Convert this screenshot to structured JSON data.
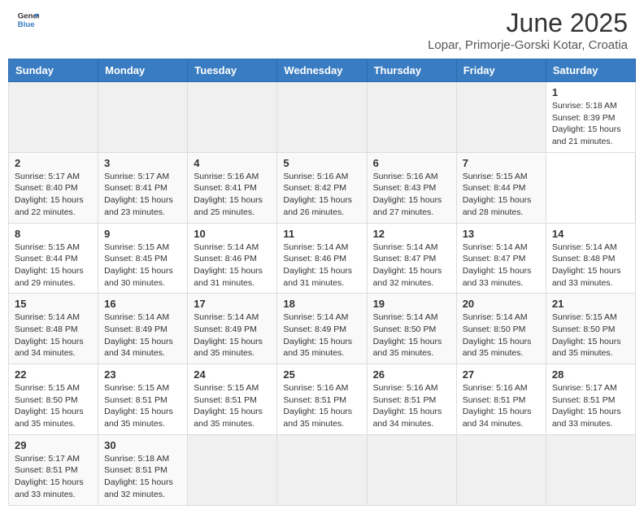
{
  "header": {
    "logo": {
      "general": "General",
      "blue": "Blue"
    },
    "title": "June 2025",
    "location": "Lopar, Primorje-Gorski Kotar, Croatia"
  },
  "calendar": {
    "days": [
      "Sunday",
      "Monday",
      "Tuesday",
      "Wednesday",
      "Thursday",
      "Friday",
      "Saturday"
    ],
    "weeks": [
      [
        null,
        null,
        null,
        null,
        null,
        null,
        {
          "day": "1",
          "sunrise": "5:18 AM",
          "sunset": "8:39 PM",
          "daylight_hours": "15",
          "daylight_minutes": "21"
        }
      ],
      [
        {
          "day": "2",
          "sunrise": "5:17 AM",
          "sunset": "8:40 PM",
          "daylight_hours": "15",
          "daylight_minutes": "22"
        },
        {
          "day": "3",
          "sunrise": "5:17 AM",
          "sunset": "8:41 PM",
          "daylight_hours": "15",
          "daylight_minutes": "23"
        },
        {
          "day": "4",
          "sunrise": "5:16 AM",
          "sunset": "8:41 PM",
          "daylight_hours": "15",
          "daylight_minutes": "25"
        },
        {
          "day": "5",
          "sunrise": "5:16 AM",
          "sunset": "8:42 PM",
          "daylight_hours": "15",
          "daylight_minutes": "26"
        },
        {
          "day": "6",
          "sunrise": "5:16 AM",
          "sunset": "8:43 PM",
          "daylight_hours": "15",
          "daylight_minutes": "27"
        },
        {
          "day": "7",
          "sunrise": "5:15 AM",
          "sunset": "8:44 PM",
          "daylight_hours": "15",
          "daylight_minutes": "28"
        }
      ],
      [
        {
          "day": "8",
          "sunrise": "5:15 AM",
          "sunset": "8:44 PM",
          "daylight_hours": "15",
          "daylight_minutes": "29"
        },
        {
          "day": "9",
          "sunrise": "5:15 AM",
          "sunset": "8:45 PM",
          "daylight_hours": "15",
          "daylight_minutes": "30"
        },
        {
          "day": "10",
          "sunrise": "5:14 AM",
          "sunset": "8:46 PM",
          "daylight_hours": "15",
          "daylight_minutes": "31"
        },
        {
          "day": "11",
          "sunrise": "5:14 AM",
          "sunset": "8:46 PM",
          "daylight_hours": "15",
          "daylight_minutes": "31"
        },
        {
          "day": "12",
          "sunrise": "5:14 AM",
          "sunset": "8:47 PM",
          "daylight_hours": "15",
          "daylight_minutes": "32"
        },
        {
          "day": "13",
          "sunrise": "5:14 AM",
          "sunset": "8:47 PM",
          "daylight_hours": "15",
          "daylight_minutes": "33"
        },
        {
          "day": "14",
          "sunrise": "5:14 AM",
          "sunset": "8:48 PM",
          "daylight_hours": "15",
          "daylight_minutes": "33"
        }
      ],
      [
        {
          "day": "15",
          "sunrise": "5:14 AM",
          "sunset": "8:48 PM",
          "daylight_hours": "15",
          "daylight_minutes": "34"
        },
        {
          "day": "16",
          "sunrise": "5:14 AM",
          "sunset": "8:49 PM",
          "daylight_hours": "15",
          "daylight_minutes": "34"
        },
        {
          "day": "17",
          "sunrise": "5:14 AM",
          "sunset": "8:49 PM",
          "daylight_hours": "15",
          "daylight_minutes": "35"
        },
        {
          "day": "18",
          "sunrise": "5:14 AM",
          "sunset": "8:49 PM",
          "daylight_hours": "15",
          "daylight_minutes": "35"
        },
        {
          "day": "19",
          "sunrise": "5:14 AM",
          "sunset": "8:50 PM",
          "daylight_hours": "15",
          "daylight_minutes": "35"
        },
        {
          "day": "20",
          "sunrise": "5:14 AM",
          "sunset": "8:50 PM",
          "daylight_hours": "15",
          "daylight_minutes": "35"
        },
        {
          "day": "21",
          "sunrise": "5:15 AM",
          "sunset": "8:50 PM",
          "daylight_hours": "15",
          "daylight_minutes": "35"
        }
      ],
      [
        {
          "day": "22",
          "sunrise": "5:15 AM",
          "sunset": "8:50 PM",
          "daylight_hours": "15",
          "daylight_minutes": "35"
        },
        {
          "day": "23",
          "sunrise": "5:15 AM",
          "sunset": "8:51 PM",
          "daylight_hours": "15",
          "daylight_minutes": "35"
        },
        {
          "day": "24",
          "sunrise": "5:15 AM",
          "sunset": "8:51 PM",
          "daylight_hours": "15",
          "daylight_minutes": "35"
        },
        {
          "day": "25",
          "sunrise": "5:16 AM",
          "sunset": "8:51 PM",
          "daylight_hours": "15",
          "daylight_minutes": "35"
        },
        {
          "day": "26",
          "sunrise": "5:16 AM",
          "sunset": "8:51 PM",
          "daylight_hours": "15",
          "daylight_minutes": "34"
        },
        {
          "day": "27",
          "sunrise": "5:16 AM",
          "sunset": "8:51 PM",
          "daylight_hours": "15",
          "daylight_minutes": "34"
        },
        {
          "day": "28",
          "sunrise": "5:17 AM",
          "sunset": "8:51 PM",
          "daylight_hours": "15",
          "daylight_minutes": "33"
        }
      ],
      [
        {
          "day": "29",
          "sunrise": "5:17 AM",
          "sunset": "8:51 PM",
          "daylight_hours": "15",
          "daylight_minutes": "33"
        },
        {
          "day": "30",
          "sunrise": "5:18 AM",
          "sunset": "8:51 PM",
          "daylight_hours": "15",
          "daylight_minutes": "32"
        },
        null,
        null,
        null,
        null,
        null
      ]
    ]
  }
}
